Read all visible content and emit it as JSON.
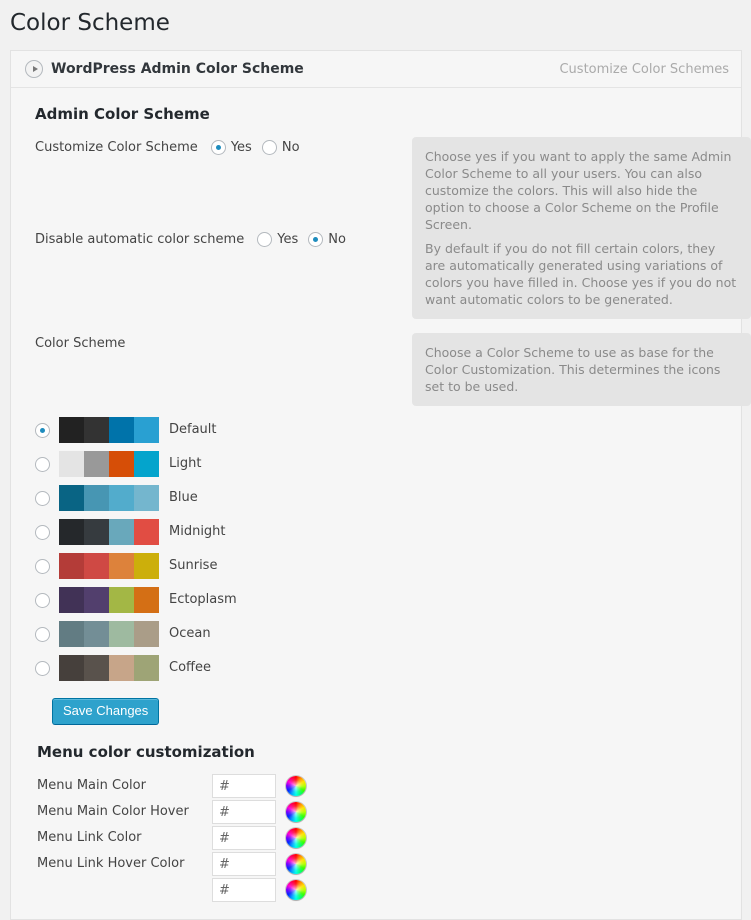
{
  "page": {
    "title": "Color Scheme"
  },
  "panel": {
    "toggle_icon": "triangle-right-icon",
    "title": "WordPress Admin Color Scheme",
    "link_label": "Customize Color Schemes"
  },
  "admin_section": {
    "heading": "Admin Color Scheme",
    "options": [
      {
        "label": "Customize Color Scheme",
        "choices": [
          {
            "label": "Yes",
            "checked": true
          },
          {
            "label": "No",
            "checked": false
          }
        ],
        "help": "Choose yes if you want to apply the same Admin Color Scheme to all your users. You can also customize the colors. This will also hide the option to choose a Color Scheme on the Profile Screen."
      },
      {
        "label": "Disable automatic color scheme",
        "choices": [
          {
            "label": "Yes",
            "checked": false
          },
          {
            "label": "No",
            "checked": true
          }
        ],
        "help": "By default if you do not fill certain colors, they are automatically generated using variations of colors you have filled in. Choose yes if you do not want automatic colors to be generated."
      },
      {
        "label": "Color Scheme",
        "choices": [],
        "help": "Choose a Color Scheme to use as base for the Color Customization. This determines the icons set to be used."
      }
    ]
  },
  "schemes": [
    {
      "name": "Default",
      "checked": true,
      "colors": [
        "#222222",
        "#333333",
        "#0073aa",
        "#29a0d2"
      ]
    },
    {
      "name": "Light",
      "checked": false,
      "colors": [
        "#e4e4e4",
        "#999999",
        "#d64e07",
        "#04a4cc"
      ]
    },
    {
      "name": "Blue",
      "checked": false,
      "colors": [
        "#096484",
        "#4796b3",
        "#52accc",
        "#74b6ce"
      ]
    },
    {
      "name": "Midnight",
      "checked": false,
      "colors": [
        "#25282b",
        "#363b3f",
        "#69a8bb",
        "#e14d43"
      ]
    },
    {
      "name": "Sunrise",
      "checked": false,
      "colors": [
        "#b43c38",
        "#cf4944",
        "#dd823b",
        "#ccaf0b"
      ]
    },
    {
      "name": "Ectoplasm",
      "checked": false,
      "colors": [
        "#413256",
        "#523f6d",
        "#a3b745",
        "#d46f15"
      ]
    },
    {
      "name": "Ocean",
      "checked": false,
      "colors": [
        "#627c83",
        "#738e96",
        "#9ebaa0",
        "#aa9d88"
      ]
    },
    {
      "name": "Coffee",
      "checked": false,
      "colors": [
        "#46403c",
        "#59524c",
        "#c7a589",
        "#9ea476"
      ]
    }
  ],
  "save": {
    "label": "Save Changes"
  },
  "menu_colors": {
    "heading": "Menu color customization",
    "fields": [
      {
        "label": "Menu Main Color",
        "value": "#",
        "picker_icon": "color-wheel-icon"
      },
      {
        "label": "Menu Main Color Hover",
        "value": "#",
        "picker_icon": "color-wheel-icon"
      },
      {
        "label": "Menu Link Color",
        "value": "#",
        "picker_icon": "color-wheel-icon"
      },
      {
        "label": "Menu Link Hover Color",
        "value": "#",
        "picker_icon": "color-wheel-icon"
      },
      {
        "label": "",
        "value": "#",
        "picker_icon": "color-wheel-icon"
      }
    ]
  },
  "theme": {
    "accent": "#2ea2cc",
    "radio_dot": "#1e8cbe",
    "page_bg": "#f1f1f1",
    "panel_bg": "#f6f6f6",
    "help_bg": "#e4e4e4"
  }
}
